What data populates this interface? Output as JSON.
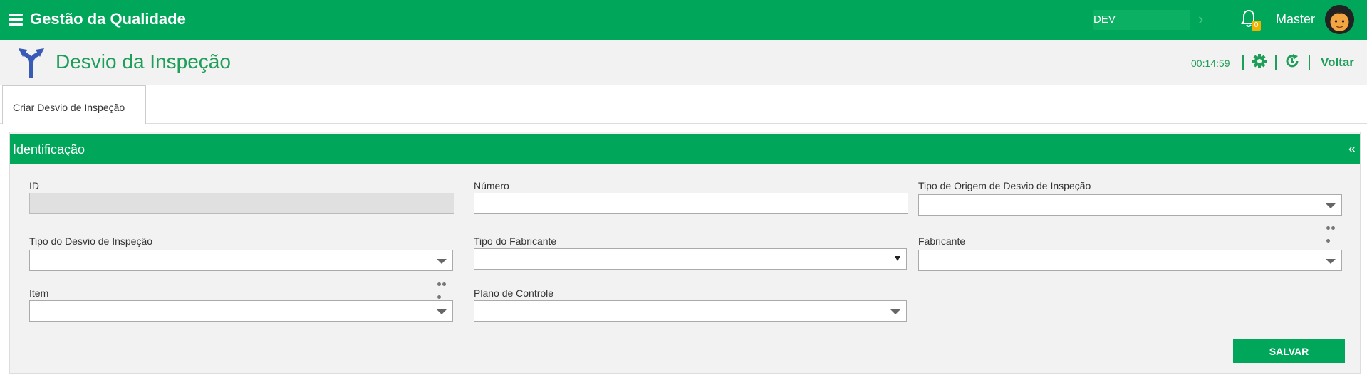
{
  "app": {
    "title": "Gestão da Qualidade",
    "environment": "DEV",
    "notifications": "0",
    "user": "Master"
  },
  "page": {
    "title": "Desvio da Inspeção",
    "timer": "00:14:59",
    "back_label": "Voltar"
  },
  "tabs": [
    {
      "label": "Criar Desvio de Inspeção"
    }
  ],
  "section": {
    "title": "Identificação",
    "collapse": "«"
  },
  "fields": {
    "id": {
      "label": "ID",
      "value": ""
    },
    "numero": {
      "label": "Número",
      "value": ""
    },
    "tipo_origem": {
      "label": "Tipo de Origem de Desvio de Inspeção",
      "value": ""
    },
    "tipo_desvio": {
      "label": "Tipo do Desvio de Inspeção",
      "value": ""
    },
    "tipo_fabricante": {
      "label": "Tipo do Fabricante",
      "value": ""
    },
    "fabricante": {
      "label": "Fabricante",
      "value": ""
    },
    "item": {
      "label": "Item",
      "value": ""
    },
    "plano_controle": {
      "label": "Plano de Controle",
      "value": ""
    }
  },
  "actions": {
    "save_label": "SALVAR"
  },
  "colors": {
    "brand": "#00a65a",
    "accent_text": "#1e9e58",
    "icon_blue": "#3a5bb5"
  }
}
